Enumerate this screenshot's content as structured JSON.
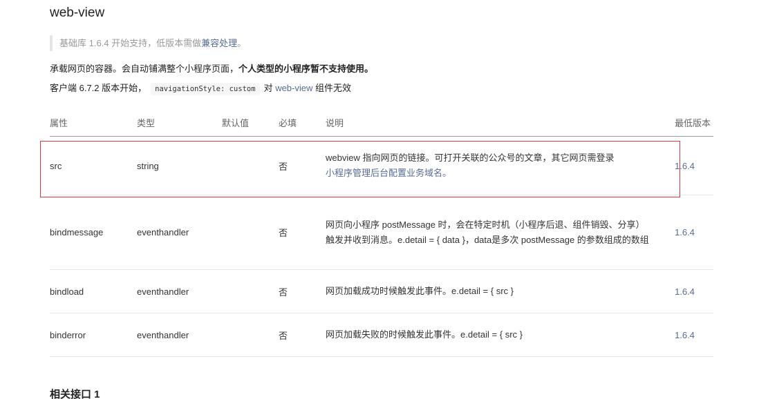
{
  "title": "web-view",
  "note": {
    "text": "基础库 1.6.4 开始支持，低版本需做",
    "link": "兼容处理",
    "suffix": "。"
  },
  "desc1": {
    "text": "承载网页的容器。会自动铺满整个小程序页面，",
    "bold": "个人类型的小程序暂不支持使用。"
  },
  "desc2": {
    "prefix": "客户端 6.7.2 版本开始，",
    "code": "navigationStyle: custom",
    "mid": "对",
    "link": "web-view",
    "suffix": "组件无效"
  },
  "table": {
    "headers": [
      "属性",
      "类型",
      "默认值",
      "必填",
      "说明",
      "最低版本"
    ],
    "rows": [
      {
        "name": "src",
        "type": "string",
        "default": "",
        "required": "否",
        "desc": "webview 指向网页的链接。可打开关联的公众号的文章，其它网页需登录",
        "desc_link": "小程序管理后台配置业务域名。",
        "version": "1.6.4"
      },
      {
        "name": "bindmessage",
        "type": "eventhandler",
        "default": "",
        "required": "否",
        "desc": "网页向小程序 postMessage 时，会在特定时机（小程序后退、组件销毁、分享）触发并收到消息。e.detail = { data }，data是多次 postMessage 的参数组成的数组",
        "version": "1.6.4"
      },
      {
        "name": "bindload",
        "type": "eventhandler",
        "default": "",
        "required": "否",
        "desc": "网页加载成功时候触发此事件。e.detail = { src }",
        "version": "1.6.4"
      },
      {
        "name": "binderror",
        "type": "eventhandler",
        "default": "",
        "required": "否",
        "desc": "网页加载失败的时候触发此事件。e.detail = { src }",
        "version": "1.6.4"
      }
    ]
  },
  "section_title": "相关接口 1",
  "colors": {
    "link": "#576b95",
    "highlight_border": "#d9363e"
  }
}
